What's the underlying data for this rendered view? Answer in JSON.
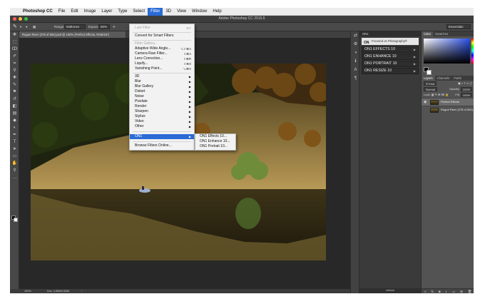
{
  "menubar": {
    "apple": "",
    "items": [
      "Photoshop CC",
      "File",
      "Edit",
      "Image",
      "Layer",
      "Type",
      "Select",
      "Filter",
      "3D",
      "View",
      "Window",
      "Help"
    ]
  },
  "window": {
    "title": "Adobe Photoshop CC 2015.5"
  },
  "options_bar": {
    "range_label": "Range:",
    "range_value": "Midtones",
    "exposure_label": "Exposure:",
    "exposure_value": "50%",
    "workspace": "Essentials"
  },
  "document": {
    "tab_title": "Rogue River (278 of 592).psd @ 100% (Perfect Effects, RGB/16*)"
  },
  "status": {
    "zoom": "100%",
    "doc": "Doc: 4.95M/9.83M"
  },
  "filter_menu": {
    "last_filter": {
      "label": "Last Filter",
      "shortcut": "⌘F"
    },
    "convert": "Convert for Smart Filters",
    "filter_gallery": "Filter Gallery...",
    "adaptive": {
      "label": "Adaptive Wide Angle...",
      "shortcut": "⌥⇧⌘A"
    },
    "camera_raw": {
      "label": "Camera Raw Filter...",
      "shortcut": "⇧⌘A"
    },
    "lens": {
      "label": "Lens Correction...",
      "shortcut": "⇧⌘R"
    },
    "liquify": {
      "label": "Liquify...",
      "shortcut": "⇧⌘X"
    },
    "vanishing": {
      "label": "Vanishing Point...",
      "shortcut": "⌥⌘V"
    },
    "groups": [
      "3D",
      "Blur",
      "Blur Gallery",
      "Distort",
      "Noise",
      "Pixelate",
      "Render",
      "Sharpen",
      "Stylize",
      "Video",
      "Other"
    ],
    "on1": "ON1",
    "browse": "Browse Filters Online..."
  },
  "on1_submenu": [
    "ON1 Effects 10...",
    "ON1 Enhance 10...",
    "ON1 Portrait 10..."
  ],
  "on1_panel": {
    "header": "ON1",
    "brand": "Focused on Photography®",
    "buttons": [
      "ON1 EFFECTS 10",
      "ON1 ENHANCE 10",
      "ON1 PORTRAIT 10",
      "ON1 RESIZE 10"
    ],
    "footer": "refresh"
  },
  "color_panel": {
    "tabs": [
      "Color",
      "Swatches"
    ]
  },
  "layers_panel": {
    "tabs": [
      "Layers",
      "Channels",
      "Paths"
    ],
    "kind": "Kind",
    "blend": "Normal",
    "opacity_label": "Opacity:",
    "opacity": "100%",
    "lock_label": "Lock:",
    "fill_label": "Fill:",
    "fill": "100%",
    "layers": [
      "Perfect Effects",
      "Rogue River (278 of 592)"
    ]
  },
  "colors": {
    "accent": "#2a6bd6",
    "panel": "#535353",
    "canvas": "#282828"
  }
}
